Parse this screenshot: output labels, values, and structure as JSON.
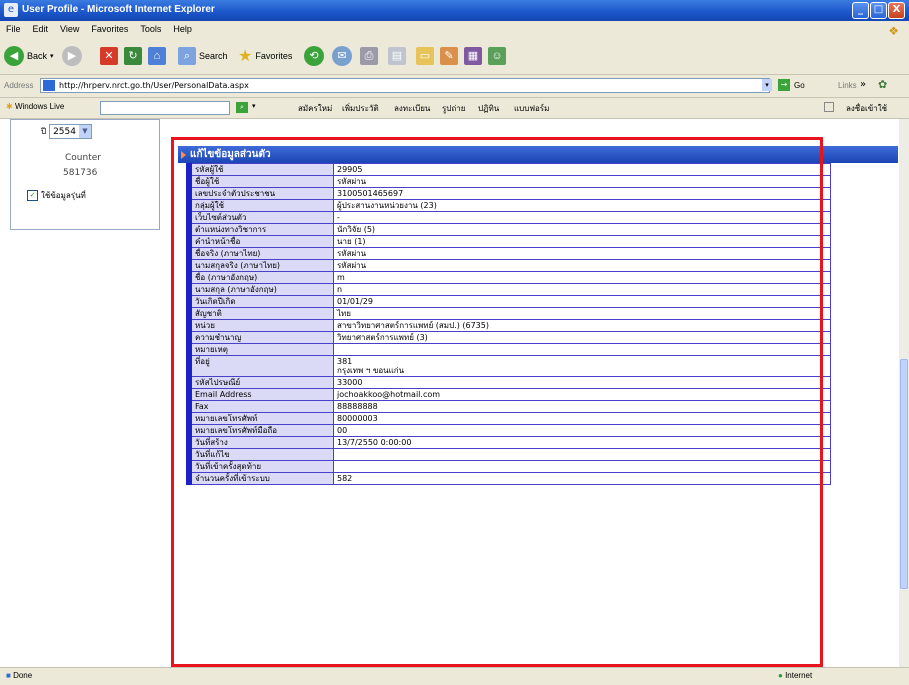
{
  "window": {
    "title": "User Profile - Microsoft Internet Explorer",
    "min": "_",
    "max": "□",
    "close": "X"
  },
  "menu": [
    "File",
    "Edit",
    "View",
    "Favorites",
    "Tools",
    "Help"
  ],
  "toolbar": {
    "back": "Back",
    "search": "Search",
    "favorites": "Favorites"
  },
  "address": {
    "label": "Address",
    "url": "http://hrperv.nrct.go.th/User/PersonalData.aspx",
    "go": "Go",
    "links": "Links"
  },
  "linksbar": {
    "label": "Windows Live",
    "items": [
      "สมัครใหม่",
      "เพิ่มประวัติ",
      "ลงทะเบียน",
      "รูปถ่าย",
      "ปฏิทิน",
      "แบบฟอร์ม"
    ],
    "right": "ลงชื่อเข้าใช้"
  },
  "left": {
    "year_label": "ปี",
    "year": "2554",
    "counter_label": "Counter",
    "counter_value": "581736",
    "checkbox_label": "ใช้ข้อมูลรุ่นที่"
  },
  "panel_title": "แก้ไขข้อมูลส่วนตัว",
  "rows": [
    {
      "label": "รหัสผู้ใช้",
      "value": "29905"
    },
    {
      "label": "ชื่อผู้ใช้",
      "value": "รหัสผ่าน"
    },
    {
      "label": "เลขประจำตัวประชาชน",
      "value": "3100501465697"
    },
    {
      "label": "กลุ่มผู้ใช้",
      "value": "ผู้ประสานงานหน่วยงาน (23)"
    },
    {
      "label": "เว็บไซต์ส่วนตัว",
      "value": "-"
    },
    {
      "label": "ตำแหน่งทางวิชาการ",
      "value": "นักวิจัย (5)"
    },
    {
      "label": "คำนำหน้าชื่อ",
      "value": "นาย (1)"
    },
    {
      "label": "ชื่อจริง (ภาษาไทย)",
      "value": "รหัสผ่าน"
    },
    {
      "label": "นามสกุลจริง (ภาษาไทย)",
      "value": "รหัสผ่าน"
    },
    {
      "label": "ชื่อ (ภาษาอังกฤษ)",
      "value": "m"
    },
    {
      "label": "นามสกุล (ภาษาอังกฤษ)",
      "value": "n"
    },
    {
      "label": "วันเกิดปีเกิด",
      "value": "01/01/29"
    },
    {
      "label": "สัญชาติ",
      "value": "ไทย"
    },
    {
      "label": "หน่วย",
      "value": "สาขาวิทยาศาสตร์การแพทย์ (สมป.) (6735)"
    },
    {
      "label": "ความชำนาญ",
      "value": "วิทยาศาสตร์การแพทย์ (3)"
    },
    {
      "label": "หมายเหตุ",
      "value": ""
    },
    {
      "label": "ที่อยู่",
      "value": "381",
      "value2": "กรุงเทพ ฯ ขอนแก่น"
    },
    {
      "label": "รหัสไปรษณีย์",
      "value": "33000"
    },
    {
      "label": "Email Address",
      "value": "jochoakkoo@hotmail.com"
    },
    {
      "label": "Fax",
      "value": "88888888"
    },
    {
      "label": "หมายเลขโทรศัพท์",
      "value": "80000003"
    },
    {
      "label": "หมายเลขโทรศัพท์มือถือ",
      "value": "00"
    },
    {
      "label": "วันที่สร้าง",
      "value": "13/7/2550 0:00:00"
    },
    {
      "label": "วันที่แก้ไข",
      "value": ""
    },
    {
      "label": "วันที่เข้าครั้งสุดท้าย",
      "value": ""
    },
    {
      "label": "จำนวนครั้งที่เข้าระบบ",
      "value": "582"
    }
  ],
  "status": {
    "text": "Done",
    "zone": "Internet"
  },
  "colors": {
    "highlight": "#e8141e",
    "row_label_bg": "#dad9f6",
    "panel_header": "#1c45b5"
  }
}
